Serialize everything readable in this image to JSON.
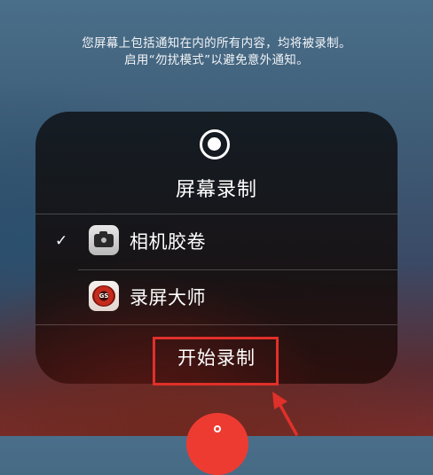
{
  "notice": {
    "line1": "您屏幕上包括通知在内的所有内容，均将被录制。",
    "line2": "启用“勿扰模式”以避免意外通知。"
  },
  "panel": {
    "icon": "record-icon",
    "title": "屏幕录制",
    "options": [
      {
        "label": "相机胶卷",
        "icon": "camera-app-icon",
        "selected": true,
        "check": "✓"
      },
      {
        "label": "录屏大师",
        "icon": "screen-recorder-app-icon",
        "selected": false,
        "app_mark": "GS"
      }
    ],
    "start_label": "开始录制"
  },
  "annotation": {
    "color": "#e0302a"
  },
  "bottom_button": {
    "icon": "record-control-icon",
    "color": "#ee3b32"
  }
}
